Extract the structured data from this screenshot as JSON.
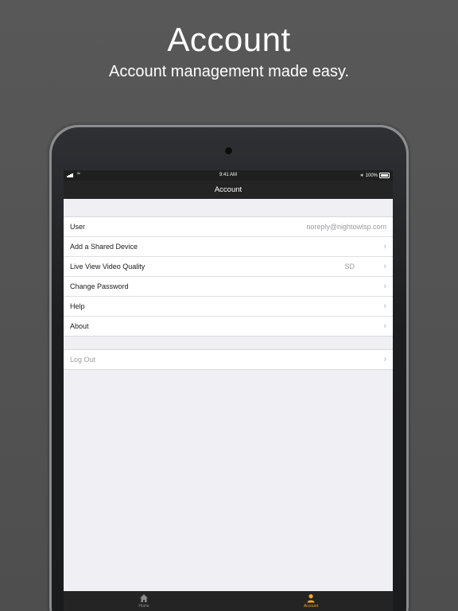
{
  "promo": {
    "title": "Account",
    "subtitle": "Account management made easy."
  },
  "statusbar": {
    "time": "9:41 AM",
    "battery": "100%"
  },
  "navbar": {
    "title": "Account"
  },
  "account_section": [
    {
      "label": "User",
      "value": "noreply@nightowlsp.com"
    },
    {
      "label": "Add a Shared Device"
    },
    {
      "label": "Live View Video Quality",
      "value": "SD"
    },
    {
      "label": "Change Password"
    },
    {
      "label": "Help"
    },
    {
      "label": "About"
    }
  ],
  "logout_section": {
    "label": "Log Out"
  },
  "tabbar": {
    "home_label": "Home",
    "account_label": "Account",
    "active_color": "#f0a623",
    "inactive_color": "#8d8d8d"
  },
  "icons": {
    "chevron": "chevron-right-icon",
    "home": "home-icon",
    "account": "person-icon"
  }
}
